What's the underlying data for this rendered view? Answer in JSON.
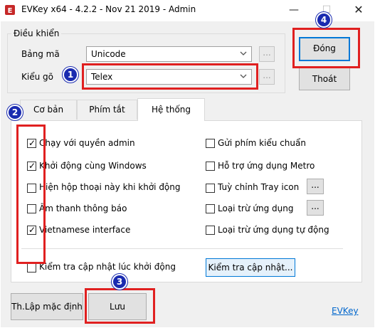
{
  "window": {
    "title": "EVKey x64 - 4.2.2 - Nov 21 2019 - Admin",
    "min_symbol": "—",
    "max_symbol": "☐",
    "close_symbol": "✕"
  },
  "control_group": {
    "label": "Điều khiển",
    "charset_label": "Bảng mã",
    "charset_value": "Unicode",
    "typing_label": "Kiểu gõ",
    "typing_value": "Telex",
    "more_button": "..."
  },
  "buttons": {
    "close_app": "Đóng",
    "exit": "Thoát",
    "defaults": "Th.Lập mặc định",
    "save": "Lưu",
    "check_update": "Kiểm tra cập nhật..."
  },
  "tabs": [
    {
      "label": "Cơ bản"
    },
    {
      "label": "Phím tắt"
    },
    {
      "label": "Hệ thống"
    }
  ],
  "left_options": [
    {
      "label": "Chạy với quyền admin",
      "checked": true
    },
    {
      "label": "Khởi động cùng Windows",
      "checked": true
    },
    {
      "label": "Hiện hộp thoại này khi khởi động",
      "checked": false
    },
    {
      "label": "Âm thanh thông báo",
      "checked": false
    },
    {
      "label": "Vietnamese interface",
      "checked": true
    }
  ],
  "right_options": [
    {
      "label": "Gửi phím kiểu chuẩn",
      "checked": false
    },
    {
      "label": "Hỗ trợ ứng dụng Metro",
      "checked": false
    },
    {
      "label": "Tuỳ chỉnh Tray icon",
      "checked": false,
      "has_button": true,
      "button": "..."
    },
    {
      "label": "Loại trừ ứng dụng",
      "checked": false,
      "has_button": true,
      "button": "..."
    },
    {
      "label": "Loại trừ ứng dụng tự động",
      "checked": false
    }
  ],
  "update_option": {
    "label": "Kiểm tra cập nhật lúc khởi động",
    "checked": false
  },
  "link": "EVKey",
  "annotations": [
    "1",
    "2",
    "3",
    "4"
  ],
  "colors": {
    "annotation_red": "#e02020",
    "annotation_marker": "#1a2bb0",
    "focus_blue": "#0078d7",
    "link": "#0066cc"
  }
}
